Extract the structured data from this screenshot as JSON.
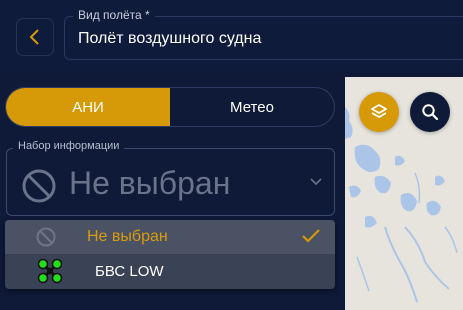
{
  "header": {
    "back_icon": "chevron-left-icon",
    "flight_type_label": "Вид полёта *",
    "flight_type_value": "Полёт воздушного судна"
  },
  "tabs": [
    {
      "label": "АНИ",
      "active": true
    },
    {
      "label": "Метео",
      "active": false
    }
  ],
  "info_set": {
    "label": "Набор информации",
    "value": "Не выбран",
    "value_icon": "ban-icon",
    "expand_icon": "chevron-down-icon"
  },
  "dropdown": {
    "options": [
      {
        "label": "Не выбран",
        "icon": "ban-icon",
        "selected": true
      },
      {
        "label": "БВС LOW",
        "icon": "drone-icon",
        "selected": false
      }
    ]
  },
  "map_controls": {
    "layers_icon": "layers-icon",
    "search_icon": "search-icon"
  },
  "colors": {
    "background": "#0e1a38",
    "accent": "#d69908",
    "map_land": "#e6e4dc",
    "map_water": "#abc5e8",
    "drone_green": "#22e01c"
  }
}
